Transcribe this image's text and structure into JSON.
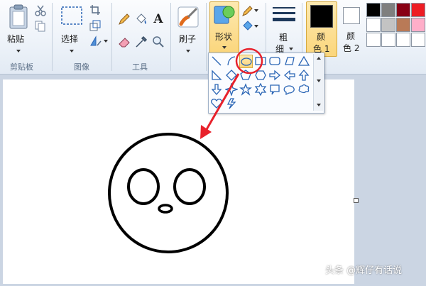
{
  "ribbon": {
    "clipboard": {
      "paste_label": "粘贴",
      "group_label": "剪贴板"
    },
    "image": {
      "select_label": "选择",
      "group_label": "图像"
    },
    "tools": {
      "group_label": "工具",
      "text_tool_glyph": "A"
    },
    "brushes": {
      "label": "刷子"
    },
    "shapes": {
      "label": "形状"
    },
    "size": {
      "label_line1": "粗",
      "label_line2": "细"
    },
    "color1": {
      "label_line1": "颜",
      "label_line2": "色 1",
      "color": "#000000"
    },
    "color2": {
      "label_line1": "颜",
      "label_line2": "色 2",
      "color": "#ffffff"
    },
    "palette": [
      "#000000",
      "#7f7f7f",
      "#880015",
      "#ed1c24",
      "#ffffff",
      "#c3c3c3",
      "#b97a57",
      "#ffaec9",
      "#ffffff",
      "#ffffff",
      "#ffffff",
      "#ffffff"
    ]
  },
  "shapes_gallery": {
    "items": [
      "line",
      "curve",
      "oval",
      "rectangle",
      "rounded-rectangle",
      "polygon",
      "triangle",
      "right-triangle",
      "diamond",
      "pentagon",
      "hexagon",
      "right-arrow",
      "left-arrow",
      "up-arrow",
      "down-arrow",
      "four-point-star",
      "five-point-star",
      "six-point-star",
      "rounded-callout",
      "oval-callout",
      "cloud-callout",
      "heart",
      "lightning"
    ],
    "selected": "oval"
  },
  "annotation": {
    "highlight_color": "#e8212b"
  },
  "watermark": {
    "text": "头条 @辉仔有话说"
  }
}
